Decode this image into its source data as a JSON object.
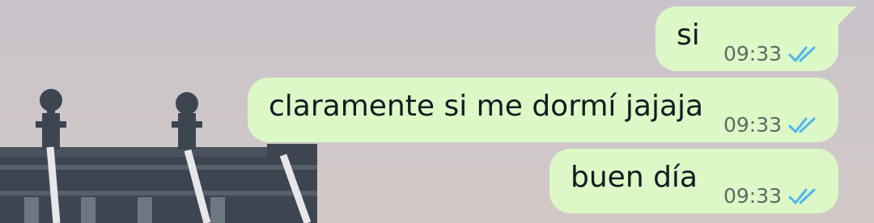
{
  "chat": {
    "messages": [
      {
        "text": "si",
        "time": "09:33",
        "status": "read-double-check-icon"
      },
      {
        "text": "claramente si me dormí jajaja",
        "time": "09:33",
        "status": "read-double-check-icon"
      },
      {
        "text": "buen día",
        "time": "09:33",
        "status": "read-double-check-icon"
      }
    ]
  },
  "colors": {
    "outgoing_bubble": "#dcf8c6",
    "read_ticks": "#4fb6ec",
    "timestamp": "#5d6b66"
  }
}
